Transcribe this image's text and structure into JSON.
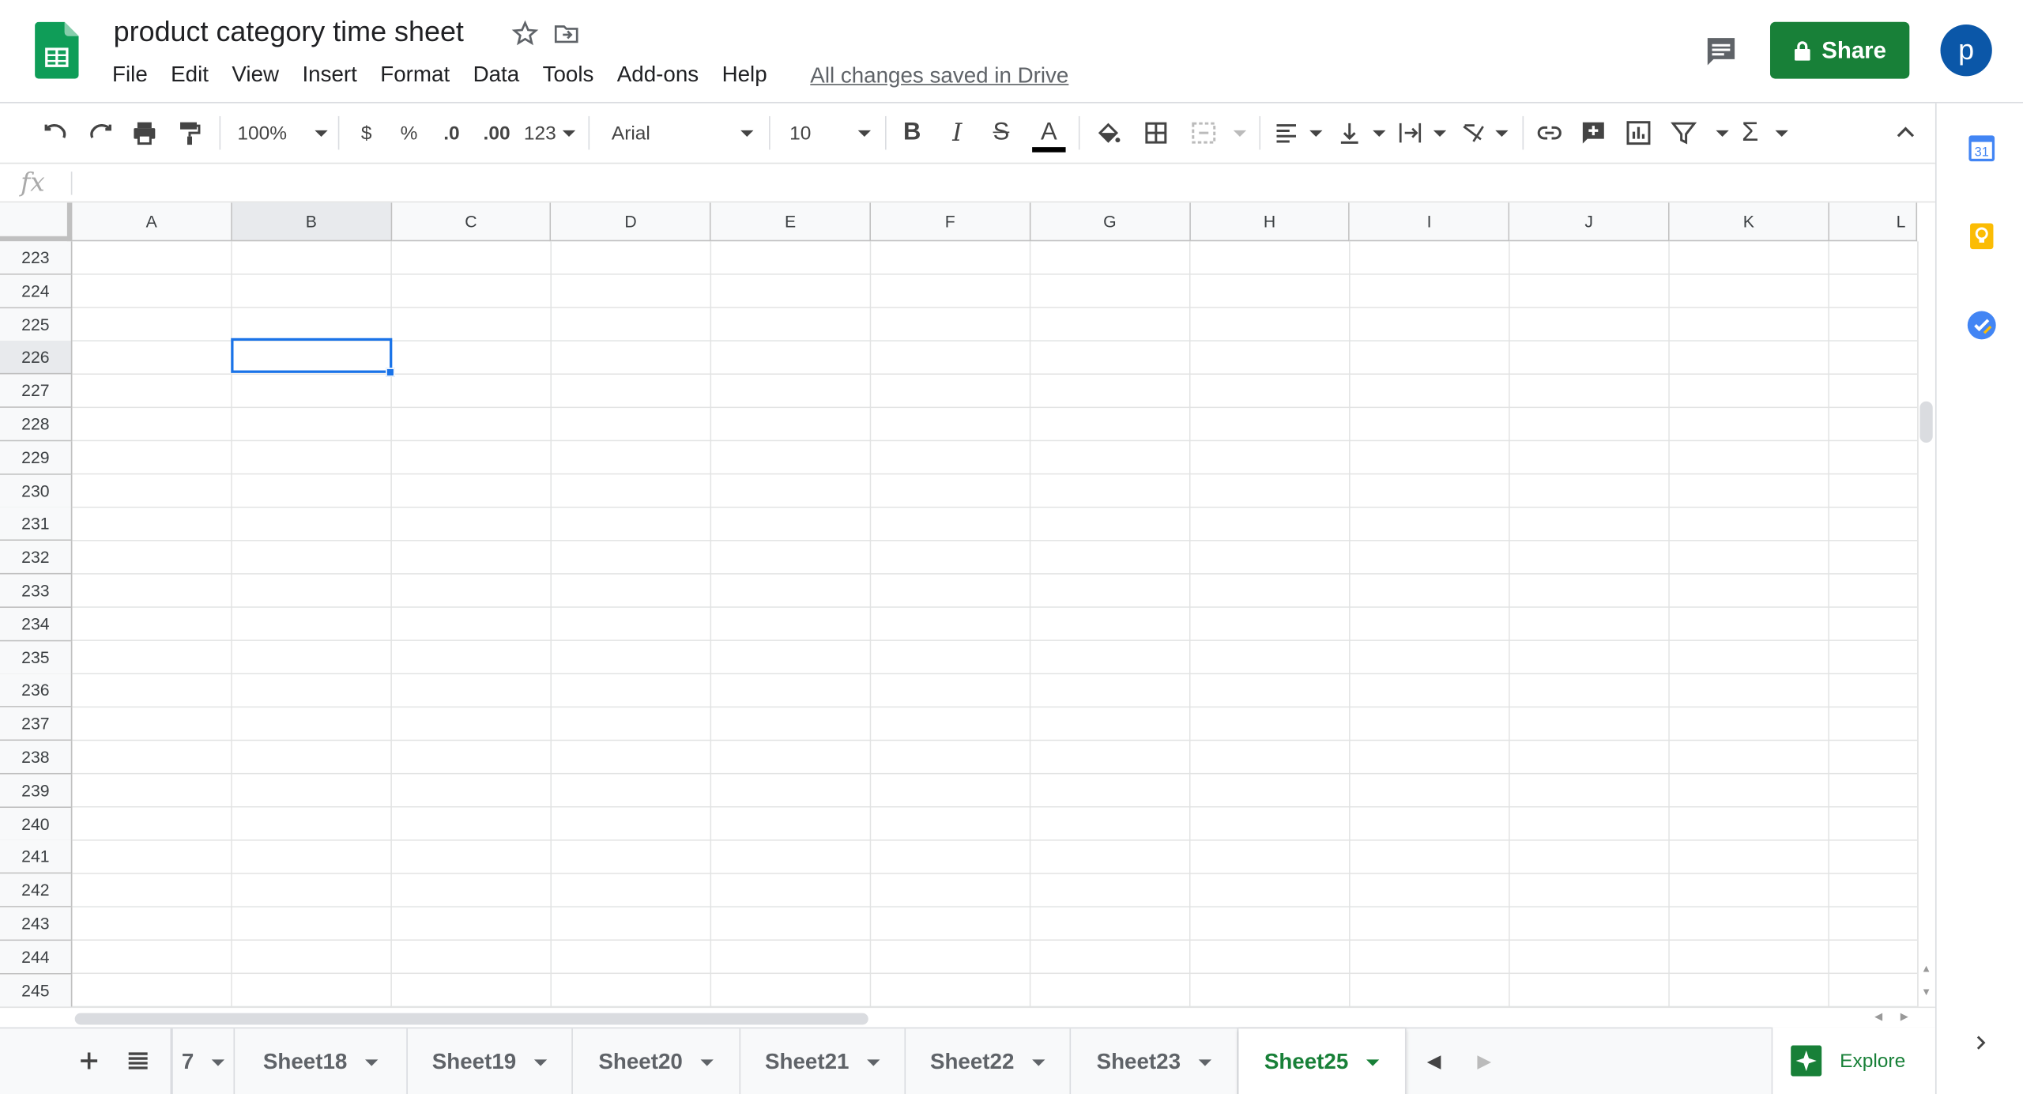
{
  "app": {
    "title": "product category time sheet",
    "save_status": "All changes saved in Drive",
    "share_label": "Share",
    "avatar_letter": "p",
    "accent": "#188038",
    "selection_color": "#1a73e8"
  },
  "menu": [
    "File",
    "Edit",
    "View",
    "Insert",
    "Format",
    "Data",
    "Tools",
    "Add-ons",
    "Help"
  ],
  "toolbar": {
    "zoom": "100%",
    "currency": "$",
    "percent": "%",
    "dec_decrease": ".0",
    "dec_increase": ".00",
    "more_formats": "123",
    "font": "Arial",
    "font_size": "10"
  },
  "formula_bar": {
    "label": "fx",
    "value": ""
  },
  "columns": [
    "A",
    "B",
    "C",
    "D",
    "E",
    "F",
    "G",
    "H",
    "I",
    "J",
    "K",
    "L"
  ],
  "rows": [
    "223",
    "224",
    "225",
    "226",
    "227",
    "228",
    "229",
    "230",
    "231",
    "232",
    "233",
    "234",
    "235",
    "236",
    "237",
    "238",
    "239",
    "240",
    "241",
    "242",
    "243",
    "244",
    "245"
  ],
  "selected_cell": "B226",
  "sheets": [
    "7",
    "Sheet18",
    "Sheet19",
    "Sheet20",
    "Sheet21",
    "Sheet22",
    "Sheet23",
    "Sheet25"
  ],
  "active_sheet": "Sheet25",
  "explore_label": "Explore",
  "side_panel": {
    "calendar_day": "31"
  }
}
